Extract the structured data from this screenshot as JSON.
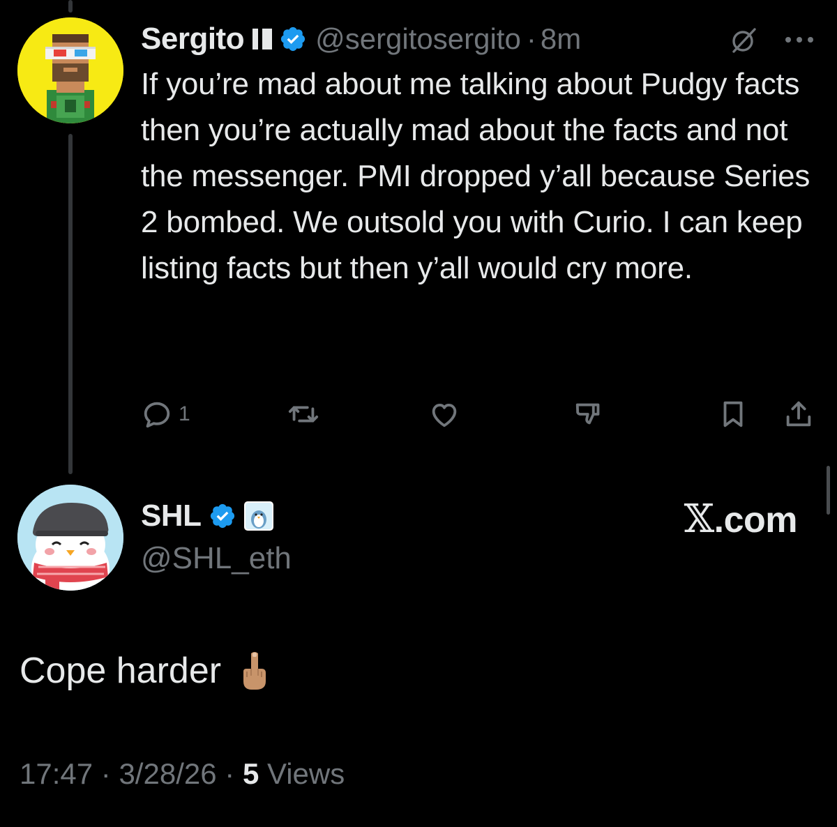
{
  "tweet_original": {
    "author_name": "Sergito",
    "handle": "@sergitosergito",
    "separator": "·",
    "time_ago": "8m",
    "body": "If you’re mad about me talking about Pudgy facts then you’re actually mad about the facts and not the messenger. PMI dropped y’all because Series 2 bombed. We outsold you with Curio. I can keep listing facts but then y’all would cry more.",
    "actions": {
      "reply_count": "1"
    },
    "icons": [
      "reply-icon",
      "repost-icon",
      "like-icon",
      "dislike-icon",
      "bookmark-icon",
      "share-icon",
      "grok-icon",
      "more-icon"
    ]
  },
  "tweet_reply": {
    "author_name": "SHL",
    "handle": "@SHL_eth",
    "body": "Cope harder",
    "emoji": "🖕🏽",
    "time": "17:47",
    "date": "3/28/26",
    "separator": "·",
    "views_count": "5",
    "views_label": "Views"
  },
  "watermark": {
    "x_glyph": "𝕏",
    "domain": ".com"
  },
  "colors": {
    "background": "#000000",
    "primary_text": "#e7e9ea",
    "secondary_text": "#71767b",
    "verified_blue": "#1d9bf0",
    "thread_line": "#333639"
  }
}
